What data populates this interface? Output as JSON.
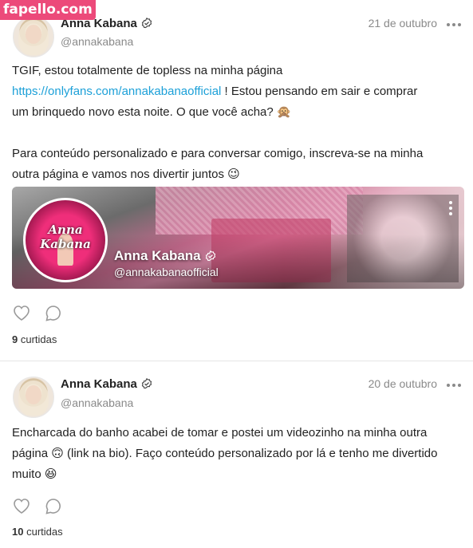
{
  "watermark": "fapello.com",
  "posts": [
    {
      "author": "Anna Kabana",
      "handle": "@annakabana",
      "date": "21 de outubro",
      "text": {
        "line1": "TGIF, estou totalmente de topless na minha página",
        "link": "https://onlyfans.com/annakabanaofficial",
        "line2a": " ! Estou pensando em sair e comprar",
        "line3": "um brinquedo novo esta noite. O que você acha? 🙊",
        "line4": "Para conteúdo personalizado e para conversar comigo, inscreva-se na minha",
        "line5": "outra página e vamos nos divertir juntos 😉"
      },
      "card": {
        "name": "Anna Kabana",
        "handle": "@annakabanaofficial",
        "logo_text": "Anna Kabana"
      },
      "likes_count": "9",
      "likes_label": "curtidas"
    },
    {
      "author": "Anna Kabana",
      "handle": "@annakabana",
      "date": "20 de outubro",
      "text": {
        "line1": "Encharcada do banho acabei de tomar e postei um videozinho na minha outra",
        "line2": "página 🙃 (link na bio). Faço conteúdo personalizado por lá e tenho me divertido",
        "line3": "muito 😆"
      },
      "likes_count": "10",
      "likes_label": "curtidas"
    }
  ],
  "icons": {
    "verified": "verified-check-icon",
    "more": "more-dots-icon",
    "like": "heart-icon",
    "comment": "comment-icon"
  },
  "colors": {
    "link": "#1ca0d8",
    "watermark_bg": "#ec4a7a",
    "muted": "#8a8a8a"
  }
}
